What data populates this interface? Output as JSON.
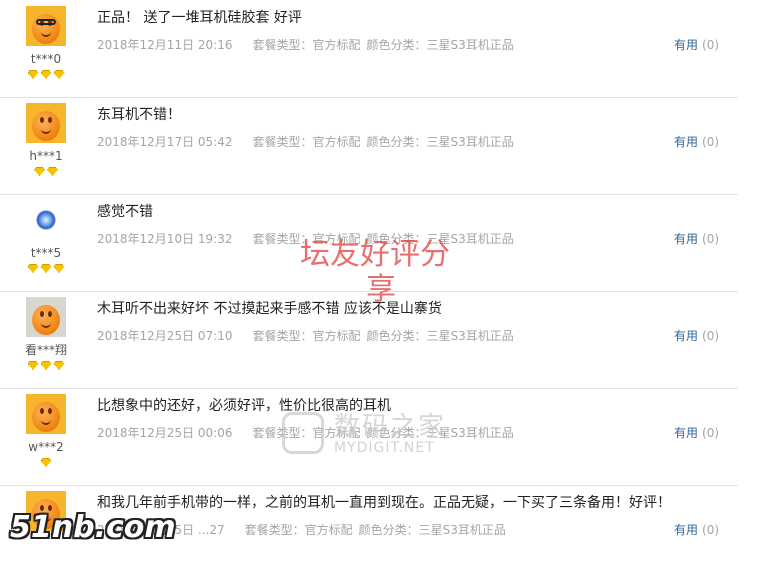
{
  "reviews": [
    {
      "user": "t***0",
      "avatar": "orange-glasses",
      "level": 3,
      "content": "正品！ 送了一堆耳机硅胶套 好评",
      "date": "2018年12月11日 20:16",
      "spec_label": "套餐类型：",
      "spec_value": "官方标配",
      "color_label": "颜色分类：",
      "color_value": "三星S3耳机正品",
      "useful_label": "有用",
      "useful_count": "(0)"
    },
    {
      "user": "h***1",
      "avatar": "orange",
      "level": 2,
      "content": "东耳机不错！",
      "date": "2018年12月17日 05:42",
      "spec_label": "套餐类型：",
      "spec_value": "官方标配",
      "color_label": "颜色分类：",
      "color_value": "三星S3耳机正品",
      "useful_label": "有用",
      "useful_count": "(0)"
    },
    {
      "user": "t***5",
      "avatar": "blue-swirl",
      "level": 3,
      "content": "感觉不错",
      "date": "2018年12月10日 19:32",
      "spec_label": "套餐类型：",
      "spec_value": "官方标配",
      "color_label": "颜色分类：",
      "color_value": "三星S3耳机正品",
      "useful_label": "有用",
      "useful_count": "(0)"
    },
    {
      "user": "看***翔",
      "avatar": "gray-orange",
      "level": 3,
      "content": "木耳听不出来好坏 不过摸起来手感不错 应该不是山寨货",
      "date": "2018年12月25日 07:10",
      "spec_label": "套餐类型：",
      "spec_value": "官方标配",
      "color_label": "颜色分类：",
      "color_value": "三星S3耳机正品",
      "useful_label": "有用",
      "useful_count": "(0)"
    },
    {
      "user": "w***2",
      "avatar": "orange",
      "level": 1,
      "content": "比想象中的还好，必须好评，性价比很高的耳机",
      "date": "2018年12月25日 00:06",
      "spec_label": "套餐类型：",
      "spec_value": "官方标配",
      "color_label": "颜色分类：",
      "color_value": "三星S3耳机正品",
      "useful_label": "有用",
      "useful_count": "(0)"
    },
    {
      "user": "",
      "avatar": "orange",
      "level": 0,
      "content": "和我几年前手机带的一样，之前的耳机一直用到现在。正品无疑，一下买了三条备用！好评！",
      "date": "2018年12月25日 ...27",
      "spec_label": "套餐类型：",
      "spec_value": "官方标配",
      "color_label": "颜色分类：",
      "color_value": "三星S3耳机正品",
      "useful_label": "有用",
      "useful_count": "(0)"
    }
  ],
  "watermarks": {
    "forum_line1": "坛友好评分",
    "forum_line2": "享",
    "mydigit_cn": "数码之家",
    "mydigit_en": "MYDIGIT.NET",
    "site": "51nb.com"
  },
  "colors": {
    "link": "#336699",
    "meta": "#a5a5a5",
    "divider": "#e4e4e4",
    "gem": "#f5c400"
  }
}
